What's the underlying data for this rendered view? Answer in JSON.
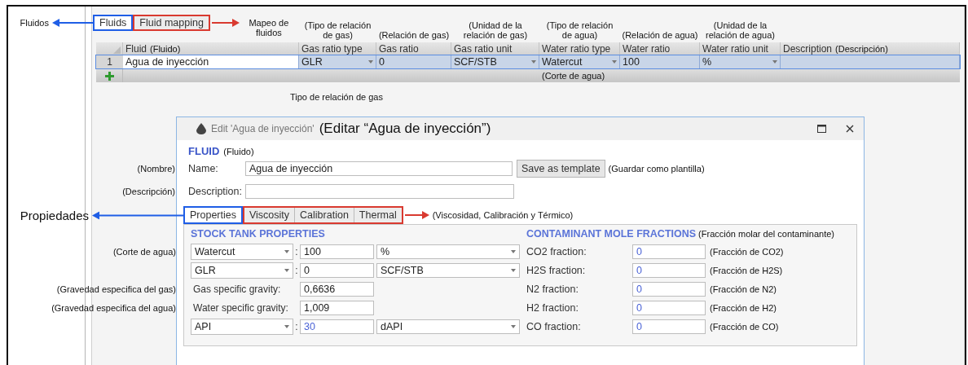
{
  "top_tabs": [
    {
      "label": "Fluids",
      "selected": true,
      "color": "#1f5ee6",
      "callout": "Fluidos"
    },
    {
      "label": "Fluid mapping",
      "selected": false,
      "color": "#d93a30",
      "callout": "Mapeo de fluidos"
    }
  ],
  "grid": {
    "columns": [
      {
        "label": "Fluid",
        "note": "(Fluido)",
        "kind": "inline"
      },
      {
        "label": "Gas ratio type",
        "note": "(Tipo de relación de gas)",
        "kind": "above"
      },
      {
        "label": "Gas ratio",
        "note": "(Relación de gas)",
        "kind": "above"
      },
      {
        "label": "Gas ratio unit",
        "note": "(Unidad de la relación de gas)",
        "kind": "above"
      },
      {
        "label": "Water ratio type",
        "note": "(Tipo de relación de agua)",
        "kind": "above",
        "below_note": "(Corte de agua)"
      },
      {
        "label": "Water ratio",
        "note": "(Relación de agua)",
        "kind": "above"
      },
      {
        "label": "Water ratio unit",
        "note": "(Unidad de la relación de agua)",
        "kind": "above"
      },
      {
        "label": "Description",
        "note": "(Descripción)",
        "kind": "inline"
      }
    ],
    "rows": [
      {
        "number": "1",
        "selected": true,
        "cells": [
          {
            "text": "Agua de inyección",
            "kind": "edit"
          },
          {
            "text": "GLR",
            "kind": "select"
          },
          {
            "text": "0",
            "kind": "text"
          },
          {
            "text": "SCF/STB",
            "kind": "select"
          },
          {
            "text": "Watercut",
            "kind": "select"
          },
          {
            "text": "100",
            "kind": "text"
          },
          {
            "text": "%",
            "kind": "select"
          },
          {
            "kind": "text"
          }
        ]
      }
    ],
    "caption": "Tipo de relación de gas"
  },
  "dialog": {
    "title": "Edit 'Agua de inyección'",
    "title_note": "(Editar “Agua de inyección”)",
    "section": "FLUID",
    "section_note": "(Fluido)",
    "name": {
      "label": "Name:",
      "value": "Agua de inyección",
      "note": "(Nombre)"
    },
    "save_button": "Save as template",
    "save_note": "(Guardar como plantilla)",
    "description": {
      "label": "Description:",
      "note": "(Descripción)"
    },
    "tabs": [
      {
        "label": "Properties",
        "selected": true,
        "color": "#1f5ee6",
        "callout": "Propiedades"
      },
      {
        "label": "Viscosity",
        "selected": false,
        "color": "#d93a30",
        "callout": "(Viscosidad, Calibración y Térmico)"
      },
      {
        "label": "Calibration",
        "selected": false,
        "color": "#d93a30"
      },
      {
        "label": "Thermal",
        "selected": false,
        "color": "#d93a30"
      }
    ],
    "stock_tank": {
      "heading": "STOCK TANK PROPERTIES",
      "rows": [
        {
          "kind": "select",
          "selector": "Watercut",
          "separator": ":",
          "value": "100",
          "unit": "%",
          "default": false,
          "note": "(Corte de agua)"
        },
        {
          "kind": "select",
          "selector": "GLR",
          "separator": ":",
          "value": "0",
          "unit": "SCF/STB",
          "default": false
        },
        {
          "kind": "plain",
          "label": "Gas specific gravity:",
          "value": "0,6636",
          "default": false,
          "note": "(Gravedad especifica del gas)"
        },
        {
          "kind": "plain",
          "label": "Water specific gravity:",
          "value": "1,009",
          "default": false,
          "note": "(Gravedad especifica del agua)"
        },
        {
          "kind": "select",
          "selector": "API",
          "separator": ":",
          "value": "30",
          "unit": "dAPI",
          "default": true
        }
      ]
    },
    "contaminants": {
      "heading": "CONTAMINANT MOLE FRACTIONS",
      "note": "(Fracción molar del contaminante)",
      "rows": [
        {
          "label": "CO2 fraction:",
          "value": "0",
          "default": true,
          "note": "(Fracción de CO2)"
        },
        {
          "label": "H2S fraction:",
          "value": "0",
          "default": true,
          "note": "(Fracción de H2S)"
        },
        {
          "label": "N2 fraction:",
          "value": "0",
          "default": true,
          "note": "(Fracción de N2)"
        },
        {
          "label": "H2 fraction:",
          "value": "0",
          "default": true,
          "note": "(Fracción de H2)"
        },
        {
          "label": "CO fraction:",
          "value": "0",
          "default": true,
          "note": "(Fracción de CO)"
        }
      ]
    }
  }
}
